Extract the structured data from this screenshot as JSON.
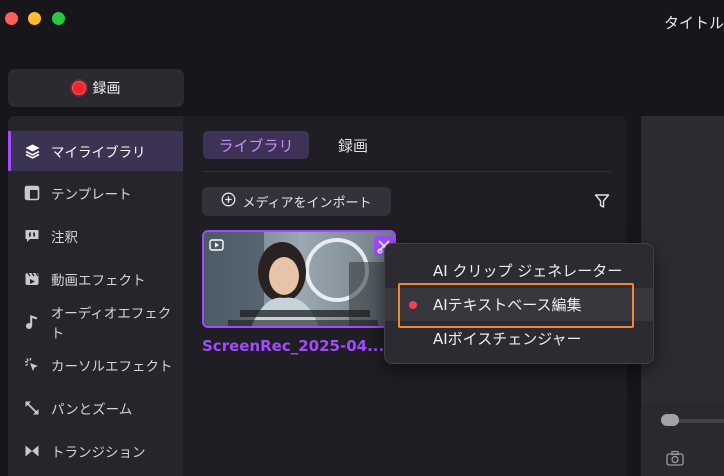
{
  "window": {
    "title": "タイトル"
  },
  "toolbar": {
    "record_label": "録画"
  },
  "sidebar": {
    "items": [
      {
        "label": "マイライブラリ",
        "icon": "layers-icon",
        "active": true
      },
      {
        "label": "テンプレート",
        "icon": "template-icon"
      },
      {
        "label": "注釈",
        "icon": "annotation-icon"
      },
      {
        "label": "動画エフェクト",
        "icon": "video-effect-icon"
      },
      {
        "label": "オーディオエフェクト",
        "icon": "music-note-icon"
      },
      {
        "label": "カーソルエフェクト",
        "icon": "cursor-click-icon"
      },
      {
        "label": "パンとズーム",
        "icon": "pan-zoom-icon"
      },
      {
        "label": "トランジション",
        "icon": "transition-icon"
      }
    ]
  },
  "library": {
    "tabs": [
      {
        "label": "ライブラリ",
        "active": true
      },
      {
        "label": "録画"
      }
    ],
    "import_label": "メディアをインポート",
    "clip": {
      "name": "ScreenRec_2025-04..."
    }
  },
  "context_menu": {
    "items": [
      {
        "label": "AI クリップ ジェネレーター"
      },
      {
        "label": "AIテキストベース編集",
        "highlighted": true
      },
      {
        "label": "AIボイスチェンジャー"
      }
    ]
  },
  "colors": {
    "accent": "#a24bff",
    "record": "#f6232d",
    "highlight_box": "#f08a32"
  }
}
